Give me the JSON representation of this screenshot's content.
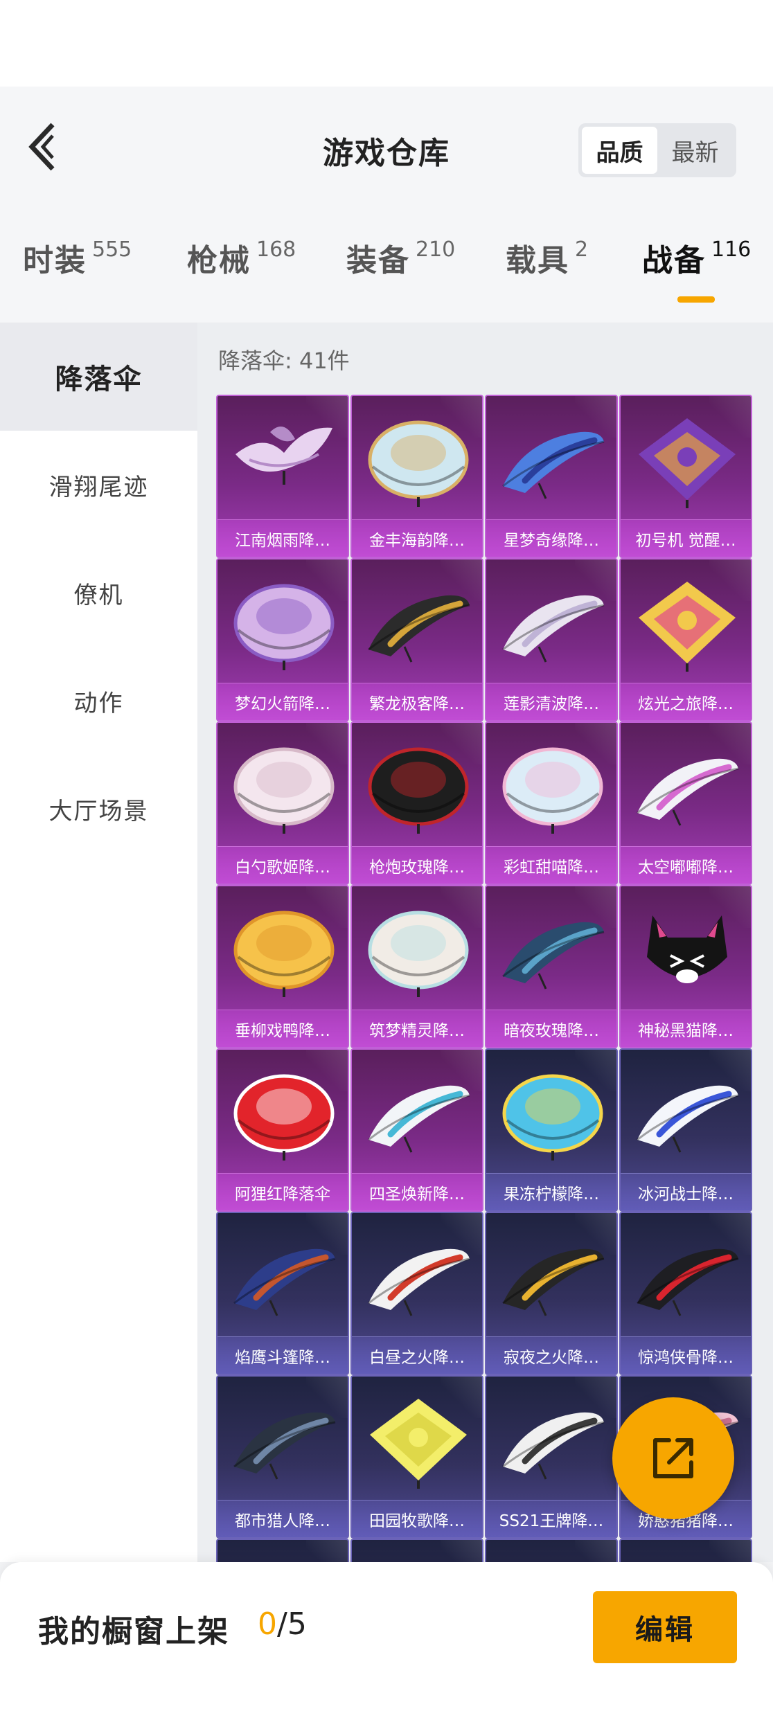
{
  "header": {
    "title": "游戏仓库",
    "sort_options": [
      "品质",
      "最新"
    ],
    "sort_selected": "品质"
  },
  "category_tabs": [
    {
      "label": "时装",
      "count": "555"
    },
    {
      "label": "枪械",
      "count": "168"
    },
    {
      "label": "装备",
      "count": "210"
    },
    {
      "label": "载具",
      "count": "2"
    },
    {
      "label": "战备",
      "count": "116",
      "active": true
    }
  ],
  "sidebar": {
    "items": [
      "降落伞",
      "滑翔尾迹",
      "僚机",
      "动作",
      "大厅场景"
    ],
    "active": "降落伞"
  },
  "content": {
    "count_label": "降落伞: 41件"
  },
  "items": [
    {
      "name": "江南烟雨降…",
      "rarity": "epic",
      "style": "flower",
      "c1": "#e8d3f0",
      "c2": "#b58cc8"
    },
    {
      "name": "金丰海韵降…",
      "rarity": "epic",
      "style": "round",
      "c1": "#cfe7f0",
      "c2": "#d9b066"
    },
    {
      "name": "星梦奇缘降…",
      "rarity": "epic",
      "style": "wing",
      "c1": "#4d7fe0",
      "c2": "#2a3f9c"
    },
    {
      "name": "初号机 觉醒…",
      "rarity": "epic",
      "style": "square",
      "c1": "#7a3fb8",
      "c2": "#e6a23c"
    },
    {
      "name": "梦幻火箭降…",
      "rarity": "epic",
      "style": "round",
      "c1": "#d5b3e8",
      "c2": "#8a5cc4"
    },
    {
      "name": "繁龙极客降…",
      "rarity": "epic",
      "style": "wing",
      "c1": "#2b2b2b",
      "c2": "#d4a53a"
    },
    {
      "name": "莲影清波降…",
      "rarity": "epic",
      "style": "wing",
      "c1": "#e9e4f0",
      "c2": "#bfb3d6"
    },
    {
      "name": "炫光之旅降…",
      "rarity": "epic",
      "style": "square",
      "c1": "#f2c94c",
      "c2": "#e14a8a"
    },
    {
      "name": "白勺歌姬降…",
      "rarity": "epic",
      "style": "round",
      "c1": "#f4e6ee",
      "c2": "#d7b9c8"
    },
    {
      "name": "枪炮玫瑰降…",
      "rarity": "epic",
      "style": "round",
      "c1": "#1e1e1e",
      "c2": "#c0252b"
    },
    {
      "name": "彩虹甜喵降…",
      "rarity": "epic",
      "style": "round",
      "c1": "#dcecf7",
      "c2": "#f2b7d4"
    },
    {
      "name": "太空嘟嘟降…",
      "rarity": "epic",
      "style": "wing",
      "c1": "#f2f2f7",
      "c2": "#d66ad0"
    },
    {
      "name": "垂柳戏鸭降…",
      "rarity": "epic",
      "style": "round",
      "c1": "#f6c24a",
      "c2": "#e0962a"
    },
    {
      "name": "筑梦精灵降…",
      "rarity": "epic",
      "style": "round",
      "c1": "#f1ece6",
      "c2": "#b8dfe3"
    },
    {
      "name": "暗夜玫瑰降…",
      "rarity": "epic",
      "style": "wing",
      "c1": "#2a4c6e",
      "c2": "#5aa3c9"
    },
    {
      "name": "神秘黑猫降…",
      "rarity": "epic",
      "style": "cat",
      "c1": "#141414",
      "c2": "#e04a8e"
    },
    {
      "name": "阿狸红降落伞",
      "rarity": "epic",
      "style": "round",
      "c1": "#e2242b",
      "c2": "#ffffff"
    },
    {
      "name": "四圣焕新降…",
      "rarity": "epic",
      "style": "wing",
      "c1": "#f2f5f8",
      "c2": "#46b8d6"
    },
    {
      "name": "果冻柠檬降…",
      "rarity": "rare",
      "style": "round",
      "c1": "#4fc3e8",
      "c2": "#f5d64a"
    },
    {
      "name": "冰河战士降…",
      "rarity": "rare",
      "style": "wing",
      "c1": "#f4f6fb",
      "c2": "#3a56d8"
    },
    {
      "name": "焰鹰斗篷降…",
      "rarity": "rare",
      "style": "wing",
      "c1": "#2d3d8a",
      "c2": "#c5562f"
    },
    {
      "name": "白昼之火降…",
      "rarity": "rare",
      "style": "wing",
      "c1": "#f2f2f2",
      "c2": "#d23b2b"
    },
    {
      "name": "寂夜之火降…",
      "rarity": "rare",
      "style": "wing",
      "c1": "#262626",
      "c2": "#e8b230"
    },
    {
      "name": "惊鸿侠骨降…",
      "rarity": "rare",
      "style": "wing",
      "c1": "#1e1e22",
      "c2": "#d9242e"
    },
    {
      "name": "都市猎人降…",
      "rarity": "rare",
      "style": "wing",
      "c1": "#2a3342",
      "c2": "#6f86a6"
    },
    {
      "name": "田园牧歌降…",
      "rarity": "rare",
      "style": "square",
      "c1": "#f3ee6a",
      "c2": "#d6cf3c"
    },
    {
      "name": "SS21王牌降…",
      "rarity": "rare",
      "style": "wing",
      "c1": "#f0f0f0",
      "c2": "#3a3a3a"
    },
    {
      "name": "娇憨猪猪降…",
      "rarity": "rare",
      "style": "wing",
      "c1": "#f2c3d4",
      "c2": "#c87090"
    },
    {
      "name": "",
      "rarity": "rare",
      "style": "none",
      "c1": "#2a2a40",
      "c2": "#2a2a40"
    },
    {
      "name": "",
      "rarity": "rare",
      "style": "none",
      "c1": "#2a2a40",
      "c2": "#2a2a40"
    },
    {
      "name": "",
      "rarity": "rare",
      "style": "none",
      "c1": "#2a2a40",
      "c2": "#2a2a40"
    },
    {
      "name": "",
      "rarity": "rare",
      "style": "none",
      "c1": "#2a2a40",
      "c2": "#2a2a40"
    }
  ],
  "fab": {
    "icon": "share-icon"
  },
  "bottom_bar": {
    "showcase_label": "我的橱窗上架",
    "showcase_current": "0",
    "showcase_total": "/5",
    "edit_label": "编辑"
  },
  "colors": {
    "accent": "#f7a600",
    "epic": "#a33db5",
    "rare": "#4f4a93"
  }
}
